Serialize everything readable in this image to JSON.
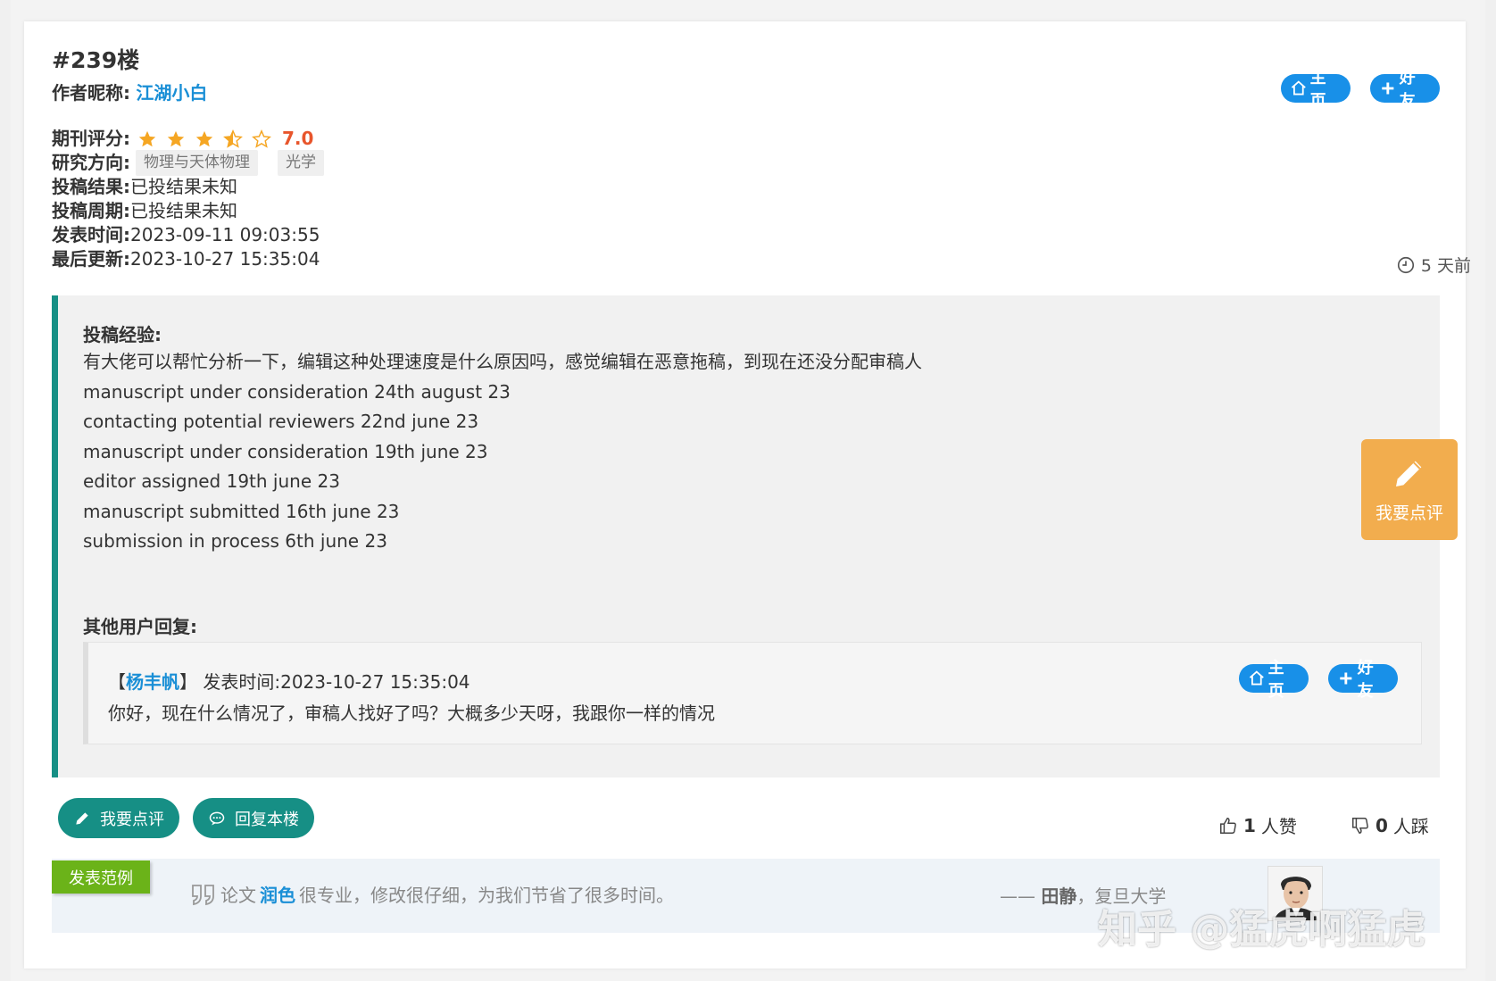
{
  "post": {
    "floor": "#239楼",
    "author_label": "作者昵称:",
    "author_name": "江湖小白",
    "home_label": "主页",
    "friend_label": "好友",
    "rating_label": "期刊评分:",
    "rating_stars": 3.5,
    "rating_value": "7.0",
    "field_label": "研究方向:",
    "field_tags": [
      "物理与天体物理",
      "光学"
    ],
    "result_label": "投稿结果:",
    "result_value": "已投结果未知",
    "period_label": "投稿周期:",
    "period_value": "已投结果未知",
    "publish_label": "发表时间:",
    "publish_value": "2023-09-11 09:03:55",
    "update_label": "最后更新:",
    "update_value": "2023-10-27 15:35:04",
    "time_ago": "5 天前"
  },
  "experience": {
    "title": "投稿经验:",
    "lines": [
      "有大佬可以帮忙分析一下，编辑这种处理速度是什么原因吗，感觉编辑在恶意拖稿，到现在还没分配审稿人",
      "manuscript under consideration 24th august 23",
      "contacting potential reviewers 22nd june 23",
      "manuscript under consideration 19th june 23",
      "editor assigned 19th june 23",
      "manuscript submitted 16th june 23",
      "submission in process 6th june 23"
    ]
  },
  "replies": {
    "title": "其他用户回复:",
    "items": [
      {
        "bracket_open": "【",
        "user": "杨丰帆",
        "bracket_close": "】",
        "time_label": "发表时间:",
        "time": "2023-10-27 15:35:04",
        "text": "你好，现在什么情况了，审稿人找好了吗？大概多少天呀，我跟你一样的情况",
        "home_label": "主页",
        "friend_label": "好友"
      }
    ]
  },
  "actions": {
    "comment_label": "我要点评",
    "reply_label": "回复本楼",
    "like_count": "1",
    "like_unit": "人赞",
    "dislike_count": "0",
    "dislike_unit": "人踩"
  },
  "example": {
    "badge": "发表范例",
    "quote_prefix": "论文",
    "quote_highlight": "润色",
    "quote_suffix": "很专业，修改很仔细，为我们节省了很多时间。",
    "author_dash": "——",
    "author_name": "田静",
    "author_org": "，复旦大学"
  },
  "float_button": {
    "label": "我要点评"
  },
  "watermark": "知乎 @猛虎啊猛虎",
  "colors": {
    "accent_teal": "#168f85",
    "link_blue": "#1a8fd6",
    "pill_blue": "#1890e8",
    "star_orange": "#f5a623",
    "rating_red": "#e8552b",
    "float_orange": "#f2ad4e",
    "badge_green": "#6bb319"
  },
  "icons": [
    "home-icon",
    "plus-icon",
    "star-icon",
    "clock-icon",
    "pencil-icon",
    "chat-icon",
    "thumbs-up-icon",
    "thumbs-down-icon",
    "quote-icon"
  ]
}
